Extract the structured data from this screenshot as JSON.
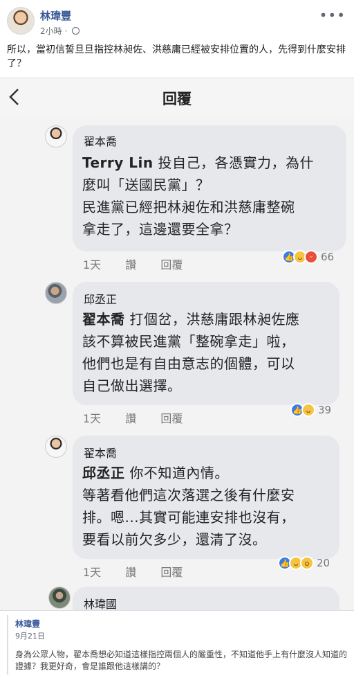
{
  "post": {
    "author": "林瑋豐",
    "time": "2小時",
    "visibility_icon": "globe-icon",
    "text": "所以，當初信誓旦旦指控林昶佐、洪慈庸已經被安排位置的人，先得到什麼安排了？"
  },
  "screenshot": {
    "title": "回覆",
    "comments": [
      {
        "name": "翟本喬",
        "mention": "Terry Lin",
        "lines": [
          "投自己，各憑實力，為什",
          "麼叫「送國民黨」？",
          "民進黨已經把林昶佐和洪慈庸整碗",
          "拿走了，這邊還要全拿？"
        ],
        "time": "1天",
        "like": "讚",
        "reply": "回覆",
        "reaction_count": "66"
      },
      {
        "name": "邱丞正",
        "mention": "翟本喬",
        "lines": [
          "打個岔，洪慈庸跟林昶佐應",
          "該不算被民進黨「整碗拿走」啦，",
          "他們也是有自由意志的個體，可以",
          "自己做出選擇。"
        ],
        "time": "1天",
        "like": "讚",
        "reply": "回覆",
        "reaction_count": "39"
      },
      {
        "name": "翟本喬",
        "mention": "邱丞正",
        "lines": [
          "你不知道內情。",
          "等著看他們這次落選之後有什麼安",
          "排。嗯...其實可能連安排也沒有，",
          "要看以前欠多少，還清了沒。"
        ],
        "time": "1天",
        "like": "讚",
        "reply": "回覆",
        "reaction_count": "20"
      },
      {
        "name": "林瑋國"
      }
    ]
  },
  "reply": {
    "author": "林瑋豐",
    "date": "9月21日",
    "text": "身為公眾人物，翟本喬想必知道這樣指控兩個人的嚴重性，不知道他手上有什麼沒人知道的證據？我更好奇，會是誰跟他這樣講的？"
  }
}
